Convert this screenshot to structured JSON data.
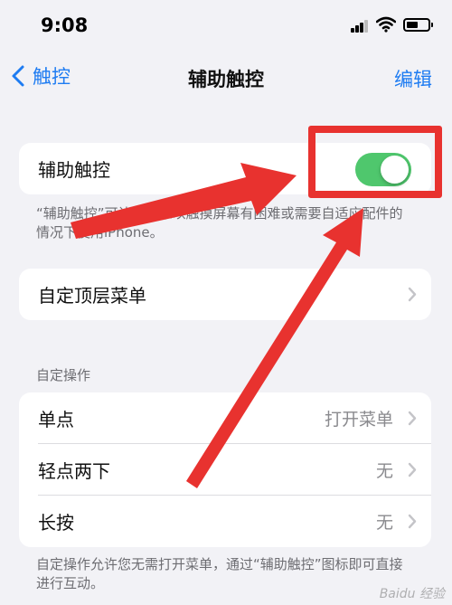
{
  "status_bar": {
    "time": "9:08"
  },
  "nav": {
    "back_label": "触控",
    "title": "辅助触控",
    "edit_label": "编辑"
  },
  "assistive_touch": {
    "label": "辅助触控",
    "enabled": true,
    "footnote": "“辅助触控”可让您在难以触摸屏幕有困难或需要自适应配件的情况下使用iPhone。"
  },
  "top_level_menu": {
    "label": "自定顶层菜单"
  },
  "custom_actions": {
    "header": "自定操作",
    "rows": [
      {
        "label": "单点",
        "value": "打开菜单"
      },
      {
        "label": "轻点两下",
        "value": "无"
      },
      {
        "label": "长按",
        "value": "无"
      }
    ],
    "footnote": "自定操作允许您无需打开菜单，通过“辅助触控”图标即可直接进行互动。"
  },
  "annotation": {
    "color": "#e8322f"
  },
  "watermark": "Baidu 经验",
  "colors": {
    "accent": "#1e7cf2",
    "toggle_on": "#4fc76d",
    "background": "#f2f2f6"
  }
}
